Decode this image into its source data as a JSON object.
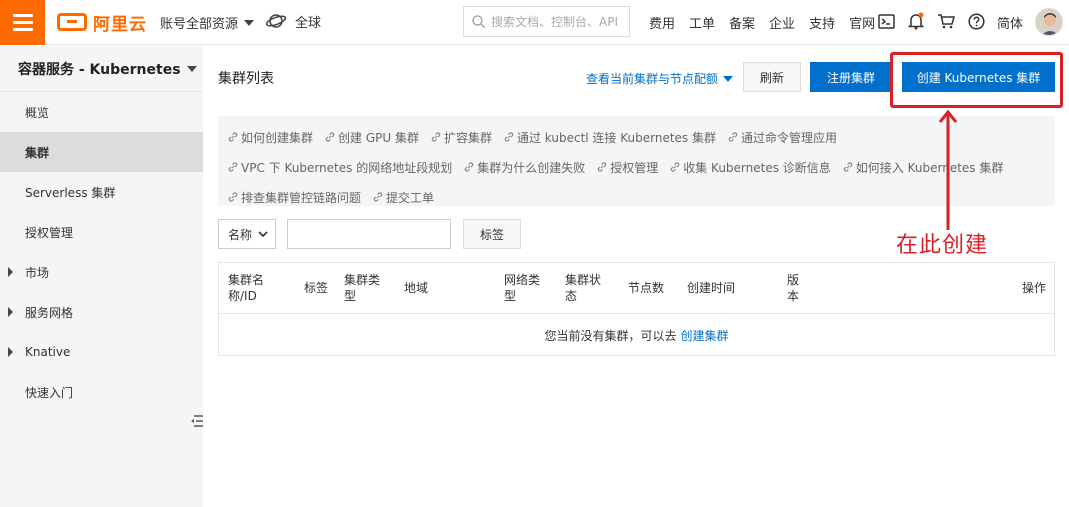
{
  "header": {
    "logo_text": "阿里云",
    "account_label": "账号全部资源",
    "region_label": "全球",
    "search_placeholder": "搜索文档、控制台、API",
    "nav": [
      "费用",
      "工单",
      "备案",
      "企业",
      "支持",
      "官网"
    ],
    "lang_label": "简体"
  },
  "sidebar": {
    "title": "容器服务 - Kubernetes",
    "items": [
      {
        "label": "概览",
        "active": false,
        "expandable": false
      },
      {
        "label": "集群",
        "active": true,
        "expandable": false
      },
      {
        "label": "Serverless 集群",
        "active": false,
        "expandable": false
      },
      {
        "label": "授权管理",
        "active": false,
        "expandable": false
      },
      {
        "label": "市场",
        "active": false,
        "expandable": true
      },
      {
        "label": "服务网格",
        "active": false,
        "expandable": true
      },
      {
        "label": "Knative",
        "active": false,
        "expandable": true
      },
      {
        "label": "快速入门",
        "active": false,
        "expandable": false
      }
    ]
  },
  "main": {
    "title": "集群列表",
    "quota_link": "查看当前集群与节点配额",
    "refresh_label": "刷新",
    "register_label": "注册集群",
    "create_label": "创建 Kubernetes 集群",
    "help_rows": [
      [
        "如何创建集群",
        "创建 GPU 集群",
        "扩容集群",
        "通过 kubectl 连接 Kubernetes 集群",
        "通过命令管理应用"
      ],
      [
        "VPC 下 Kubernetes 的网络地址段规划",
        "集群为什么创建失败",
        "授权管理",
        "收集 Kubernetes 诊断信息",
        "如何接入 Kubernetes 集群"
      ],
      [
        "排查集群管控链路问题",
        "提交工单"
      ]
    ],
    "filter_select": "名称",
    "filter_value": "",
    "tag_button": "标签",
    "table": {
      "columns": [
        "集群名称/ID",
        "标签",
        "集群类型",
        "地域",
        "网络类型",
        "集群状态",
        "节点数",
        "创建时间",
        "版本",
        "操作"
      ],
      "empty_text": "您当前没有集群，可以去",
      "empty_link": "创建集群"
    }
  },
  "annotation": {
    "text": "在此创建",
    "color": "#d92027"
  },
  "colors": {
    "brand": "#ff6a00",
    "primary": "#0070cc"
  }
}
